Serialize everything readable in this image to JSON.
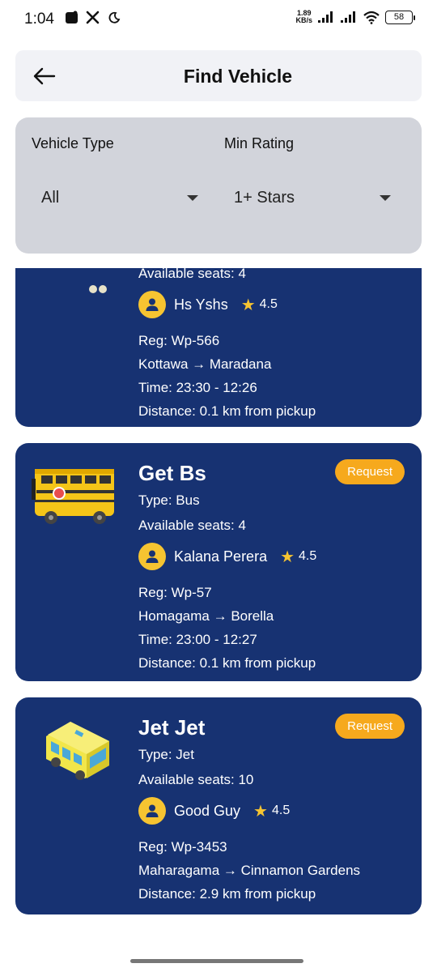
{
  "status_bar": {
    "time": "1:04",
    "net_speed_value": "1.89",
    "net_speed_unit": "KB/s",
    "battery": "58"
  },
  "app_bar": {
    "title": "Find Vehicle",
    "back_icon": "arrow-left-icon"
  },
  "filters": {
    "vehicle_type_label": "Vehicle Type",
    "vehicle_type_value": "All",
    "min_rating_label": "Min Rating",
    "min_rating_value": "1+ Stars"
  },
  "vehicles": [
    {
      "name": "",
      "type": "",
      "seats": "Available seats: 4",
      "driver": "Hs Yshs",
      "rating": "4.5",
      "reg": "Reg: Wp-566",
      "route": "Kottawa → Maradana",
      "time": "Time: 23:30 - 12:26",
      "distance": "Distance: 0.1 km from pickup"
    },
    {
      "name": "Get Bs",
      "type": "Type: Bus",
      "seats": "Available seats: 4",
      "driver": "Kalana Perera",
      "rating": "4.5",
      "reg": "Reg: Wp-57",
      "route": "Homagama → Borella",
      "time": "Time: 23:00 - 12:27",
      "distance": "Distance: 0.1 km from pickup",
      "request_label": "Request"
    },
    {
      "name": "Jet Jet",
      "type": "Type: Jet",
      "seats": "Available seats: 10",
      "driver": "Good Guy",
      "rating": "4.5",
      "reg": "Reg: Wp-3453",
      "route": "Maharagama → Cinnamon Gardens",
      "distance": "Distance: 2.9 km from pickup",
      "request_label": "Request"
    }
  ],
  "colors": {
    "card_bg": "#173272",
    "accent": "#f6a91d",
    "avatar": "#f6c431",
    "filter_bg": "#d2d4db"
  }
}
